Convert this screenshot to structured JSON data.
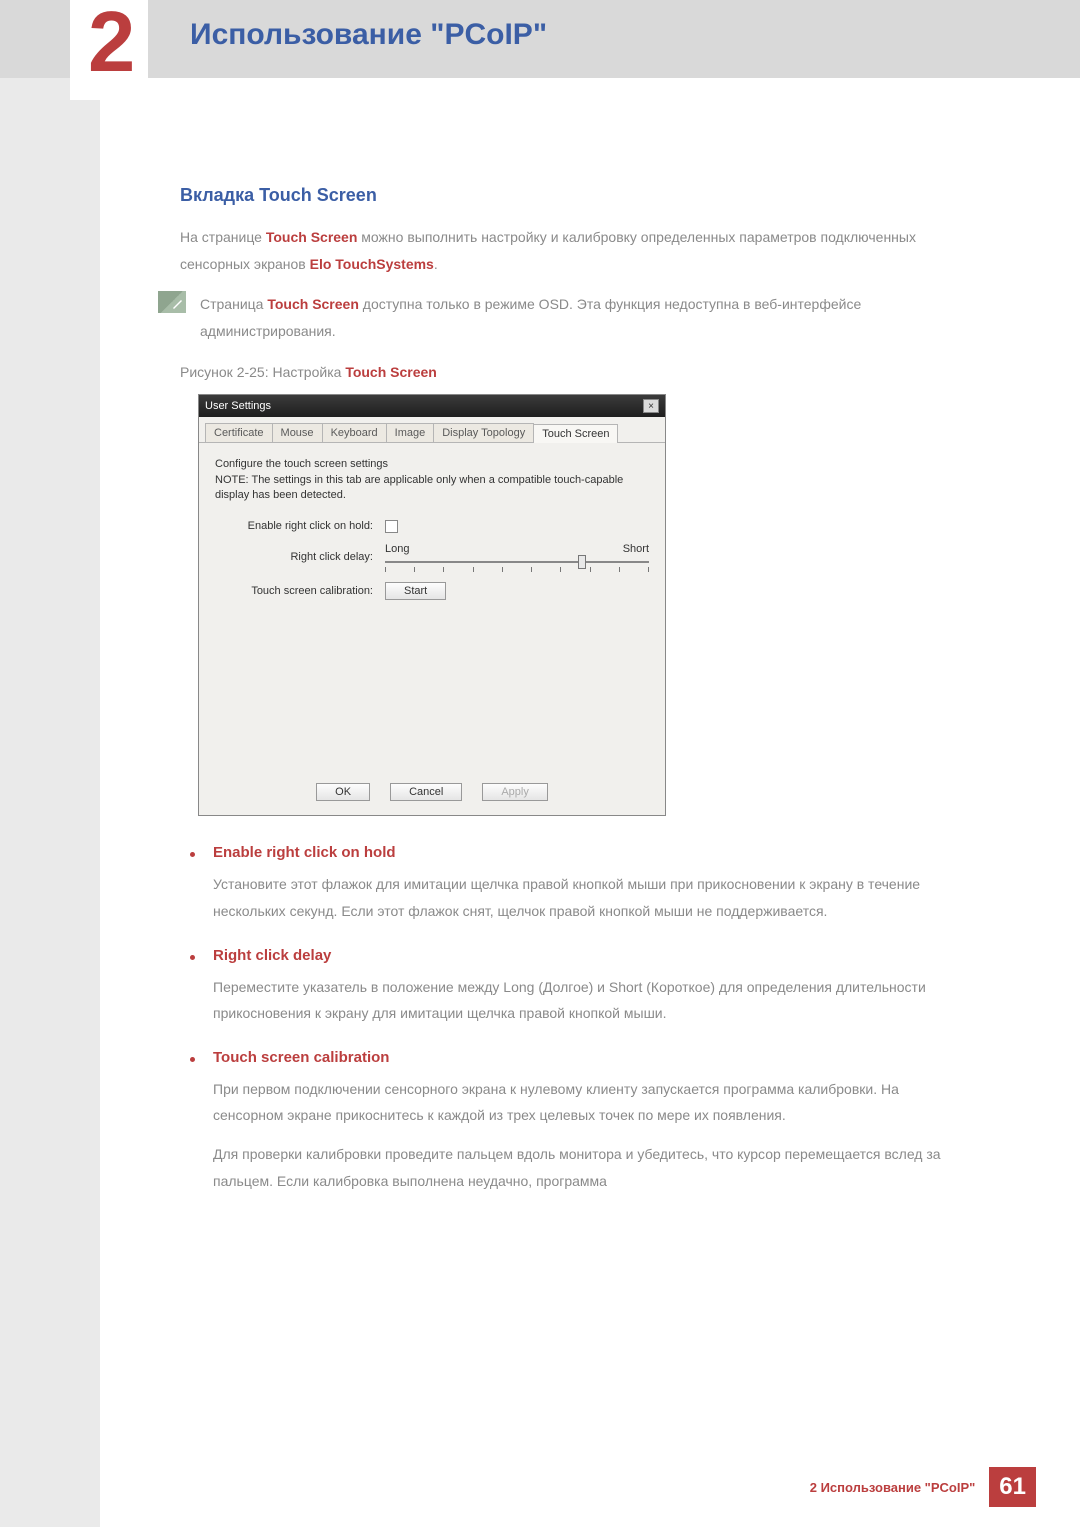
{
  "chapter": {
    "num": "2",
    "title": "Использование \"PCoIP\""
  },
  "section": {
    "heading": "Вкладка Touch Screen"
  },
  "intro": {
    "prefix": "На странице ",
    "kw1": "Touch Screen",
    "mid": " можно выполнить настройку и калибровку определенных параметров подключенных сенсорных экранов  ",
    "kw2": "Elo TouchSystems",
    "suffix": "."
  },
  "note": {
    "prefix": "Страница ",
    "kw": "Touch Screen",
    "rest": " доступна только в режиме OSD. Эта функция недоступна в веб-интерфейсе администрирования."
  },
  "figure": {
    "prefix": "Рисунок 2-25: Настройка ",
    "kw": "Touch Screen"
  },
  "dialog": {
    "title": "User Settings",
    "tabs": [
      "Certificate",
      "Mouse",
      "Keyboard",
      "Image",
      "Display Topology",
      "Touch Screen"
    ],
    "active_tab_index": 5,
    "instr1": "Configure the touch screen settings",
    "instr2": "NOTE: The settings in this tab are applicable only when a compatible touch-capable display has been detected.",
    "row1_label": "Enable right click on hold:",
    "row2_label": "Right click delay:",
    "slider_left": "Long",
    "slider_right": "Short",
    "row3_label": "Touch screen calibration:",
    "start_btn": "Start",
    "ok": "OK",
    "cancel": "Cancel",
    "apply": "Apply"
  },
  "bullets": [
    {
      "title": "Enable right click on hold",
      "paras": [
        "Установите этот флажок для имитации щелчка правой кнопкой мыши при прикосновении к экрану в течение нескольких секунд. Если этот флажок снят, щелчок правой кнопкой мыши не поддерживается."
      ]
    },
    {
      "title": "Right click delay",
      "paras": [
        "Переместите указатель в положение между Long (Долгое) и Short (Короткое) для определения длительности прикосновения к экрану для имитации щелчка правой кнопкой мыши."
      ]
    },
    {
      "title": "Touch screen calibration",
      "paras": [
        "При первом подключении сенсорного экрана к нулевому клиенту запускается программа калибровки. На сенсорном экране прикоснитесь к каждой из трех целевых точек по мере их появления.",
        "Для проверки калибровки проведите пальцем вдоль монитора и убедитесь, что курсор перемещается вслед за пальцем. Если калибровка выполнена неудачно, программа"
      ]
    }
  ],
  "footer": {
    "text": "2 Использование \"PCoIP\"",
    "page": "61"
  }
}
